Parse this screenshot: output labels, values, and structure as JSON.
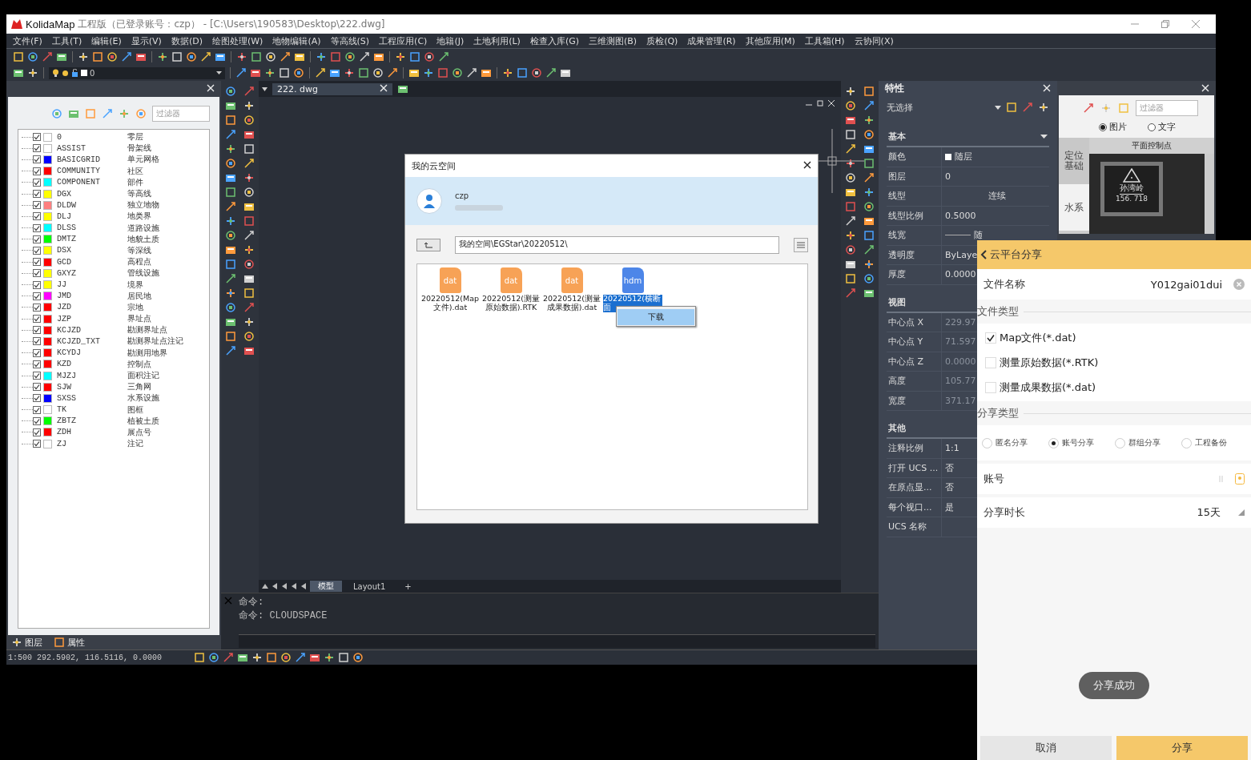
{
  "window": {
    "app_name": "KolidaMap",
    "title": "工程版（已登录账号：czp） - [C:\\Users\\190583\\Desktop\\222.dwg]"
  },
  "menu": [
    "文件(F)",
    "工具(T)",
    "编辑(E)",
    "显示(V)",
    "数据(D)",
    "绘图处理(W)",
    "地物编辑(A)",
    "等高线(S)",
    "工程应用(C)",
    "地籍(J)",
    "土地利用(L)",
    "检查入库(G)",
    "三维测图(B)",
    "质检(Q)",
    "成果管理(R)",
    "其他应用(M)",
    "工具箱(H)",
    "云协同(X)"
  ],
  "layer_dropdown": {
    "value": "0"
  },
  "layer_panel": {
    "filter_placeholder": "过滤器",
    "layers": [
      {
        "name": "0",
        "description": "零层",
        "color": "#ffffff",
        "checked": true
      },
      {
        "name": "ASSIST",
        "description": "骨架线",
        "color": "#ffffff",
        "checked": true
      },
      {
        "name": "BASICGRID",
        "description": "单元网格",
        "color": "#0000ff",
        "checked": true
      },
      {
        "name": "COMMUNITY",
        "description": "社区",
        "color": "#ff0000",
        "checked": true
      },
      {
        "name": "COMPONENT",
        "description": "部件",
        "color": "#00ffff",
        "checked": true
      },
      {
        "name": "DGX",
        "description": "等高线",
        "color": "#ffff00",
        "checked": true
      },
      {
        "name": "DLDW",
        "description": "独立地物",
        "color": "#ff8080",
        "checked": true
      },
      {
        "name": "DLJ",
        "description": "地类界",
        "color": "#ffff00",
        "checked": true
      },
      {
        "name": "DLSS",
        "description": "道路设施",
        "color": "#00ffff",
        "checked": true
      },
      {
        "name": "DMTZ",
        "description": "地貌土质",
        "color": "#00ff00",
        "checked": true
      },
      {
        "name": "DSX",
        "description": "等深线",
        "color": "#ffff00",
        "checked": true
      },
      {
        "name": "GCD",
        "description": "高程点",
        "color": "#ff0000",
        "checked": true
      },
      {
        "name": "GXYZ",
        "description": "管线设施",
        "color": "#ffff00",
        "checked": true
      },
      {
        "name": "JJ",
        "description": "境界",
        "color": "#ffff00",
        "checked": true
      },
      {
        "name": "JMD",
        "description": "居民地",
        "color": "#ff00ff",
        "checked": true
      },
      {
        "name": "JZD",
        "description": "宗地",
        "color": "#ff0000",
        "checked": true
      },
      {
        "name": "JZP",
        "description": "界址点",
        "color": "#ff0000",
        "checked": true
      },
      {
        "name": "KCJZD",
        "description": "勘测界址点",
        "color": "#ff0000",
        "checked": true
      },
      {
        "name": "KCJZD_TXT",
        "description": "勘测界址点注记",
        "color": "#ff0000",
        "checked": true
      },
      {
        "name": "KCYDJ",
        "description": "勘测用地界",
        "color": "#ff0000",
        "checked": true
      },
      {
        "name": "KZD",
        "description": "控制点",
        "color": "#ff0000",
        "checked": true
      },
      {
        "name": "MJZJ",
        "description": "面积注记",
        "color": "#00ffff",
        "checked": true
      },
      {
        "name": "SJW",
        "description": "三角网",
        "color": "#ff0000",
        "checked": true
      },
      {
        "name": "SXSS",
        "description": "水系设施",
        "color": "#0000ff",
        "checked": true
      },
      {
        "name": "TK",
        "description": "图框",
        "color": "#ffffff",
        "checked": true
      },
      {
        "name": "ZBTZ",
        "description": "植被土质",
        "color": "#00ff00",
        "checked": true
      },
      {
        "name": "ZDH",
        "description": "展点号",
        "color": "#ff0000",
        "checked": true
      },
      {
        "name": "ZJ",
        "description": "注记",
        "color": "#ffffff",
        "checked": true
      }
    ],
    "tabs": [
      "图层",
      "属性"
    ]
  },
  "drawing": {
    "tab": "222. dwg",
    "layout_tabs": [
      {
        "label": "模型",
        "selected": true
      },
      {
        "label": "Layout1",
        "selected": false
      }
    ],
    "add_layout": "+"
  },
  "command": {
    "lines": [
      "命令:",
      "命令: CLOUDSPACE"
    ]
  },
  "status_bar": {
    "coordinates": "1:500 292.5902, 116.5116, 0.0000"
  },
  "properties": {
    "title": "特性",
    "selection": "无选择",
    "sections": [
      {
        "title": "基本",
        "rows": [
          {
            "label": "颜色",
            "value": "随层",
            "kind": "swatch",
            "disabled": false
          },
          {
            "label": "图层",
            "value": "0",
            "kind": "text",
            "disabled": false
          },
          {
            "label": "线型",
            "value": "连续",
            "kind": "centered",
            "disabled": false
          },
          {
            "label": "线型比例",
            "value": "0.5000",
            "kind": "text",
            "disabled": false
          },
          {
            "label": "线宽",
            "value": "随",
            "kind": "line",
            "disabled": false
          },
          {
            "label": "透明度",
            "value": "ByLaye",
            "kind": "text",
            "disabled": false
          },
          {
            "label": "厚度",
            "value": "0.0000",
            "kind": "text",
            "disabled": false
          }
        ]
      },
      {
        "title": "视图",
        "rows": [
          {
            "label": "中心点 X",
            "value": "229.97",
            "kind": "text",
            "disabled": true
          },
          {
            "label": "中心点 Y",
            "value": "71.597",
            "kind": "text",
            "disabled": true
          },
          {
            "label": "中心点 Z",
            "value": "0.0000",
            "kind": "text",
            "disabled": true
          },
          {
            "label": "高度",
            "value": "105.77",
            "kind": "text",
            "disabled": true
          },
          {
            "label": "宽度",
            "value": "371.17",
            "kind": "text",
            "disabled": true
          }
        ]
      },
      {
        "title": "其他",
        "rows": [
          {
            "label": "注释比例",
            "value": "1:1",
            "kind": "text",
            "disabled": false
          },
          {
            "label": "打开 UCS ...",
            "value": "否",
            "kind": "text",
            "disabled": false
          },
          {
            "label": "在原点显...",
            "value": "否",
            "kind": "text",
            "disabled": false
          },
          {
            "label": "每个视口...",
            "value": "是",
            "kind": "text",
            "disabled": false
          },
          {
            "label": "UCS 名称",
            "value": "",
            "kind": "text"
          }
        ]
      }
    ]
  },
  "symbol_panel": {
    "filter_placeholder": "过滤器",
    "modes": [
      {
        "label": "图片",
        "selected": true
      },
      {
        "label": "文字",
        "selected": false
      }
    ],
    "categories": [
      {
        "label": "定位基础",
        "selected": true
      },
      {
        "label": "水系",
        "selected": false
      }
    ],
    "group": "平面控制点",
    "symbol": {
      "name": "孙湾岭",
      "elevation": "156. 718"
    }
  },
  "cloud_dialog": {
    "title": "我的云空间",
    "user": "czp",
    "path": "我的空间\\EGStar\\20220512\\",
    "files": [
      {
        "ext": "dat",
        "name": "20220512(Map文件).dat",
        "color": "#f7a256",
        "selected": false
      },
      {
        "ext": "dat",
        "name": "20220512(测量原始数据).RTK",
        "color": "#f7a256",
        "selected": false
      },
      {
        "ext": "dat",
        "name": "20220512(测量成果数据).dat",
        "color": "#f7a256",
        "selected": false
      },
      {
        "ext": "hdm",
        "name": "20220512(横断面",
        "color": "#4d86e8",
        "selected": true
      }
    ],
    "context_menu": [
      "下载"
    ]
  },
  "share": {
    "title": "云平台分享",
    "file_name_label": "文件名称",
    "file_name": "Y012gai01dui",
    "file_type_heading": "文件类型",
    "file_types": [
      {
        "label": "Map文件(*.dat)",
        "checked": true
      },
      {
        "label": "测量原始数据(*.RTK)",
        "checked": false
      },
      {
        "label": "测量成果数据(*.dat)",
        "checked": false
      }
    ],
    "share_type_heading": "分享类型",
    "share_types": [
      {
        "label": "匿名分享",
        "selected": false
      },
      {
        "label": "账号分享",
        "selected": true
      },
      {
        "label": "群组分享",
        "selected": false
      },
      {
        "label": "工程备份",
        "selected": false
      }
    ],
    "account_label": "账号",
    "duration_label": "分享时长",
    "duration": "15天",
    "toast": "分享成功",
    "buttons": [
      {
        "label": "取消",
        "kind": "secondary"
      },
      {
        "label": "分享",
        "kind": "primary"
      }
    ]
  }
}
